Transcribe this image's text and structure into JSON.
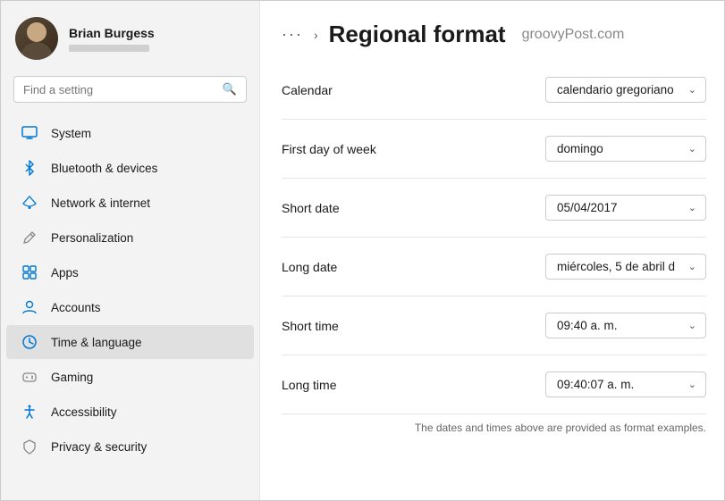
{
  "sidebar": {
    "user": {
      "name": "Brian Burgess"
    },
    "search": {
      "placeholder": "Find a setting"
    },
    "nav_items": [
      {
        "id": "system",
        "label": "System",
        "icon": "monitor",
        "active": false
      },
      {
        "id": "bluetooth",
        "label": "Bluetooth & devices",
        "icon": "bluetooth",
        "active": false
      },
      {
        "id": "network",
        "label": "Network & internet",
        "icon": "network",
        "active": false
      },
      {
        "id": "personalization",
        "label": "Personalization",
        "icon": "brush",
        "active": false
      },
      {
        "id": "apps",
        "label": "Apps",
        "icon": "grid",
        "active": false
      },
      {
        "id": "accounts",
        "label": "Accounts",
        "icon": "person",
        "active": false
      },
      {
        "id": "time",
        "label": "Time & language",
        "icon": "clock",
        "active": true
      },
      {
        "id": "gaming",
        "label": "Gaming",
        "icon": "gamepad",
        "active": false
      },
      {
        "id": "accessibility",
        "label": "Accessibility",
        "icon": "accessibility",
        "active": false
      },
      {
        "id": "privacy",
        "label": "Privacy & security",
        "icon": "shield",
        "active": false
      }
    ]
  },
  "header": {
    "dots": "···",
    "chevron": "›",
    "title": "Regional format",
    "brand": "groovyPost.com"
  },
  "settings": {
    "rows": [
      {
        "id": "calendar",
        "label": "Calendar",
        "value": "calendario gregoriano"
      },
      {
        "id": "first_day",
        "label": "First day of week",
        "value": "domingo"
      },
      {
        "id": "short_date",
        "label": "Short date",
        "value": "05/04/2017"
      },
      {
        "id": "long_date",
        "label": "Long date",
        "value": "miércoles, 5 de abril d"
      },
      {
        "id": "short_time",
        "label": "Short time",
        "value": "09:40 a. m."
      },
      {
        "id": "long_time",
        "label": "Long time",
        "value": "09:40:07 a. m."
      }
    ],
    "footer_note": "The dates and times above are provided as format examples."
  }
}
